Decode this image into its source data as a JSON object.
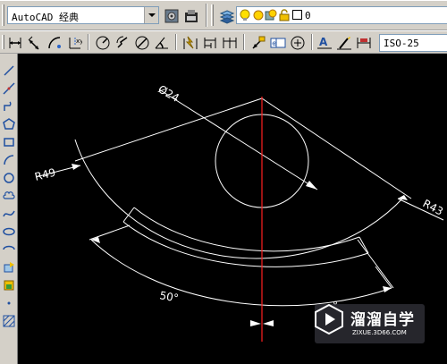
{
  "toolbar": {
    "workspace_value": "AutoCAD 经典",
    "layer_value": "0",
    "dimstyle_value": "ISO-25"
  },
  "drawing": {
    "diameter_label": "Ø24",
    "radius_left_label": "R49",
    "radius_right_label": "R43",
    "angle_label": "50°",
    "angle_label_partial": "°"
  },
  "watermark": {
    "title": "溜溜自学",
    "subtitle": "ZIXUE.3D66.COM"
  },
  "colors": {
    "canvas_background": "#000000",
    "geometry": "#ffffff",
    "centerline": "#ff0000",
    "toolbar": "#d4d0c8"
  }
}
